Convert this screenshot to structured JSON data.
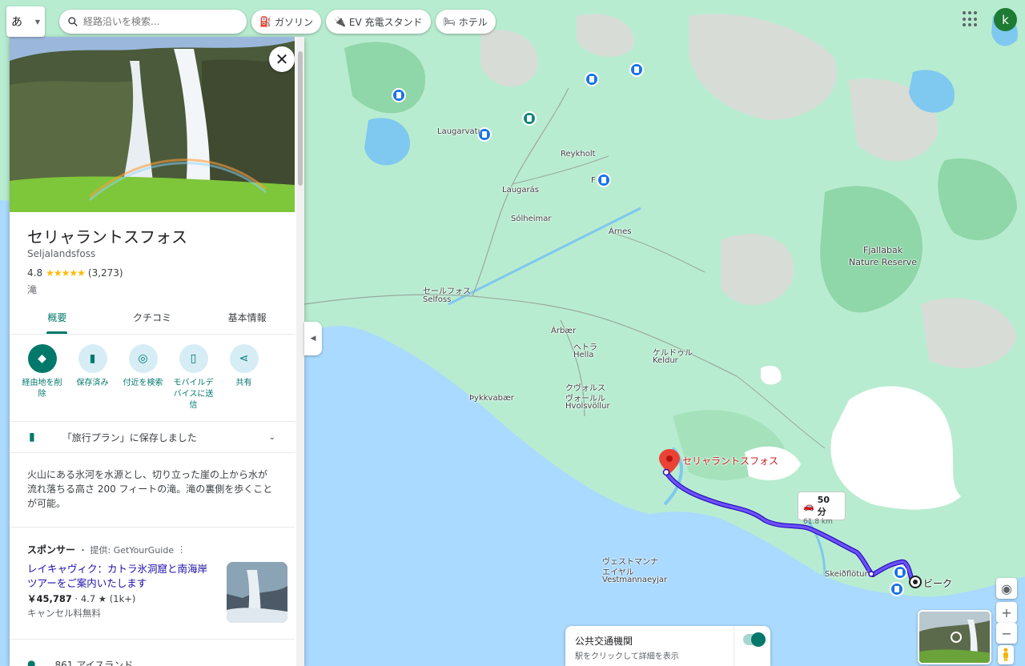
{
  "top": {
    "ime_label": "あ",
    "search_placeholder": "経路沿いを検索...",
    "chips": [
      "ガソリン",
      "EV 充電スタンド",
      "ホテル"
    ],
    "avatar_letter": "k"
  },
  "place": {
    "title": "セリャラントスフォス",
    "subtitle": "Seljalandsfoss",
    "rating": "4.8",
    "stars": "★★★★★",
    "reviews": "(3,273)",
    "category": "滝",
    "tabs": [
      "概要",
      "クチコミ",
      "基本情報"
    ],
    "actions": [
      "経由地を削除",
      "保存済み",
      "付近を検索",
      "モバイルデバイスに送信",
      "共有"
    ],
    "saved_text": "「旅行プラン」に保存しました",
    "description": "火山にある氷河を水源とし、切り立った崖の上から水が流れ落ちる高さ 200 フィートの滝。滝の裏側を歩くことが可能。"
  },
  "sponsor": {
    "label": "スポンサー",
    "provider": "・ 提供: GetYourGuide",
    "title": "レイキャヴィク：カトラ氷洞窟と南海岸ツアーをご案内いたします",
    "price": "￥45,787",
    "rating": "· 4.7 ★ (1k+)",
    "cancel": "キャンセル料無料"
  },
  "address": "861 アイスランド",
  "map": {
    "labels": {
      "laugarvatn": "Laugarvatı",
      "reykholt": "Reykholt",
      "laugaras": "Laugarás",
      "solheimar": "Sólheimar",
      "arnes": "Árnes",
      "fjallabak": "Fjallabak",
      "fjallabak2": "Nature Reserve",
      "selfoss_jp": "セールフォス",
      "selfoss": "Selfoss",
      "arbaer": "Árbær",
      "hella_jp": "ヘトラ",
      "hella": "Hella",
      "keldur_jp": "ケルドゥル",
      "keldur": "Keldur",
      "hvolsvollur_jp1": "クヴォルス",
      "hvolsvollur_jp2": "ヴォールル",
      "hvolsvollur": "Hvolsvöllur",
      "thykkvabaer": "Þykkvabær",
      "vest_jp1": "ヴェストマンナ",
      "vest_jp2": "エイヤル",
      "vest": "Vestmannaeyjar",
      "skeidflotur": "Skeiðflötur",
      "f_label": "F"
    },
    "destination": "セリャラントスフォス",
    "origin": "ビーク",
    "route_duration": "50 分",
    "route_distance": "61.8 km"
  },
  "transit": {
    "title": "公共交通機関",
    "subtitle": "駅をクリックして詳細を表示"
  },
  "colors": {
    "accent": "#00796b",
    "route": "#3d1ee0",
    "sea": "#aadaff",
    "land": "#b8ecd0",
    "pin": "#ea4335"
  }
}
